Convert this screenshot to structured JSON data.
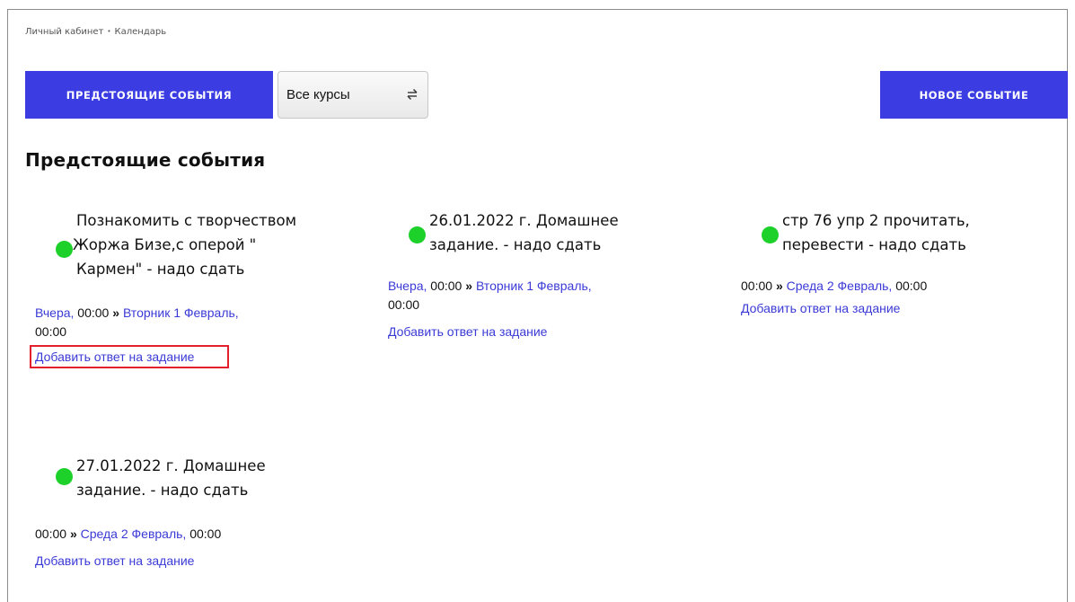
{
  "breadcrumb": {
    "items": [
      "Личный кабинет",
      "Календарь"
    ],
    "separator": "•"
  },
  "toolbar": {
    "upcoming_label": "ПРЕДСТОЯЩИЕ СОБЫТИЯ",
    "course_select_value": "Все курсы",
    "new_event_label": "НОВОЕ СОБЫТИЕ"
  },
  "page_title": "Предстоящие события",
  "colors": {
    "accent": "#3b3de3",
    "link": "#3a3ad6",
    "dot": "#1ed02a",
    "highlight": "#e3202b"
  },
  "events": [
    {
      "title_lines": [
        "Познакомить с творчеством",
        "Жоржа Бизе,с оперой \"",
        "Кармен\" - надо сдать"
      ],
      "start_link": "Вчера,",
      "start_time": " 00:00 ",
      "arrow": "»",
      "end_link": "Вторник 1 Февраль,",
      "end_time": "00:00",
      "answer_link": "Добавить ответ на задание"
    },
    {
      "title_lines": [
        "26.01.2022 г. Домашнее",
        "задание. - надо сдать"
      ],
      "start_link": "Вчера,",
      "start_time": " 00:00 ",
      "arrow": "»",
      "end_link": "Вторник 1 Февраль,",
      "end_time": "00:00",
      "answer_link": "Добавить ответ на задание"
    },
    {
      "title_lines": [
        "стр 76 упр 2 прочитать,",
        "перевести - надо сдать"
      ],
      "start_time": "00:00 ",
      "arrow": "»",
      "end_link": "Среда 2 Февраль,",
      "end_time": " 00:00",
      "answer_link": "Добавить ответ на задание"
    },
    {
      "title_lines": [
        "27.01.2022 г. Домашнее",
        "задание. - надо сдать"
      ],
      "start_time": "00:00 ",
      "arrow": "»",
      "end_link": "Среда 2 Февраль,",
      "end_time": " 00:00",
      "answer_link": "Добавить ответ на задание"
    }
  ]
}
